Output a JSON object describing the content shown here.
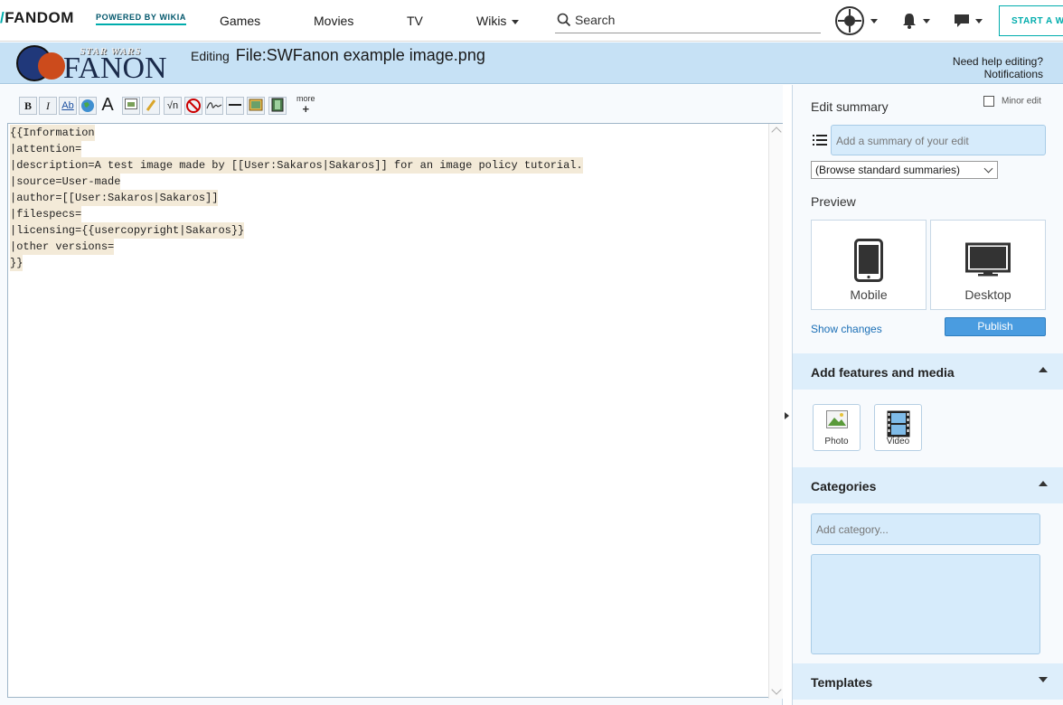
{
  "topnav": {
    "brand": "FANDOM",
    "powered": "POWERED BY WIKIA",
    "links": [
      "Games",
      "Movies",
      "TV",
      "Wikis"
    ],
    "search_label": "Search",
    "start_wiki": "START A WIKI"
  },
  "wiki": {
    "logo_top": "STAR WARS",
    "logo_main": "FANON",
    "editing_prefix": "Editing",
    "page_title": "File:SWFanon example image.png",
    "help_link": "Need help editing?",
    "notifications_link": "Notifications"
  },
  "editor": {
    "more_label": "more",
    "more_plus": "+",
    "toolbar_buttons": [
      "bold",
      "italic",
      "link",
      "external-link",
      "headline",
      "image",
      "media",
      "math",
      "nowiki",
      "signature",
      "horizontal-line",
      "gallery",
      "video"
    ],
    "lines": [
      "{{Information",
      "|attention=",
      "|description=A test image made by [[User:Sakaros|Sakaros]] for an image policy tutorial.",
      "|source=User-made",
      "|author=[[User:Sakaros|Sakaros]]",
      "|filespecs=",
      "|licensing={{usercopyright|Sakaros}}",
      "|other versions=",
      "}}"
    ]
  },
  "rail": {
    "edit_summary_label": "Edit summary",
    "minor_edit": "Minor edit",
    "summary_placeholder": "Add a summary of your edit",
    "summary_select": "(Browse standard summaries)",
    "preview_label": "Preview",
    "mobile": "Mobile",
    "desktop": "Desktop",
    "show_changes": "Show changes",
    "publish": "Publish",
    "features_heading": "Add features and media",
    "photo": "Photo",
    "video": "Video",
    "categories_heading": "Categories",
    "category_placeholder": "Add category...",
    "templates_heading": "Templates"
  }
}
